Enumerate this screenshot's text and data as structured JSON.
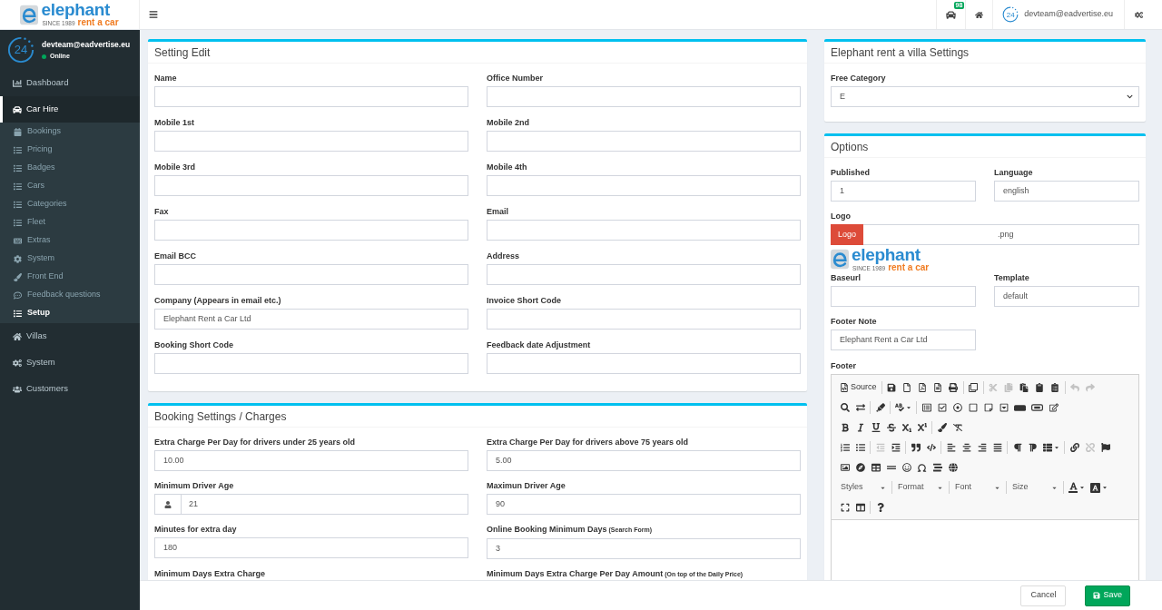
{
  "logo": {
    "name": "elephant",
    "since": "SINCE 1989",
    "tagline": "rent a car"
  },
  "navbar": {
    "notification_count": "98",
    "avatar_text": "24",
    "user_email": "devteam@eadvertise.eu"
  },
  "sidebar": {
    "user": {
      "avatar_text": "24",
      "email": "devteam@eadvertise.eu",
      "status": "Online"
    },
    "items": [
      {
        "kind": "chart",
        "label": "Dashboard",
        "selected": false
      },
      {
        "kind": "car",
        "label": "Car Hire",
        "selected": true,
        "expanded": true,
        "children": [
          {
            "kind": "calendar",
            "label": "Bookings",
            "selected": false
          },
          {
            "kind": "list",
            "label": "Pricing",
            "selected": false
          },
          {
            "kind": "list",
            "label": "Badges",
            "selected": false
          },
          {
            "kind": "list",
            "label": "Cars",
            "selected": false
          },
          {
            "kind": "list",
            "label": "Categories",
            "selected": false
          },
          {
            "kind": "list",
            "label": "Fleet",
            "selected": false
          },
          {
            "kind": "keyboard",
            "label": "Extras",
            "selected": false
          },
          {
            "kind": "gear",
            "label": "System",
            "selected": false
          },
          {
            "kind": "brush",
            "label": "Front End",
            "selected": false
          },
          {
            "kind": "comment",
            "label": "Feedback questions",
            "selected": false
          },
          {
            "kind": "list",
            "label": "Setup",
            "selected": true
          }
        ]
      },
      {
        "kind": "home",
        "label": "Villas",
        "selected": false
      },
      {
        "kind": "gears",
        "label": "System",
        "selected": false
      },
      {
        "kind": "users",
        "label": "Customers",
        "selected": false
      }
    ]
  },
  "setting_edit": {
    "title": "Setting Edit",
    "fields": [
      {
        "label": "Name"
      },
      {
        "label": "Office Number"
      },
      {
        "label": "Mobile 1st"
      },
      {
        "label": "Mobile 2nd"
      },
      {
        "label": "Mobile 3rd"
      },
      {
        "label": "Mobile 4th"
      },
      {
        "label": "Fax"
      },
      {
        "label": "Email"
      },
      {
        "label": "Email BCC"
      },
      {
        "label": "Address"
      },
      {
        "label": "Company (Appears in email etc.)",
        "value": "Elephant Rent a Car Ltd"
      },
      {
        "label": "Invoice Short Code"
      },
      {
        "label": "Booking Short Code"
      },
      {
        "label": "Feedback date Adjustment"
      }
    ]
  },
  "booking_settings": {
    "title": "Booking Settings / Charges",
    "fields": [
      {
        "kind": "text",
        "label": "Extra Charge Per Day for drivers under 25 years old",
        "value": "10.00"
      },
      {
        "kind": "text",
        "label": "Extra Charge Per Day for drivers above 75 years old",
        "value": "5.00"
      },
      {
        "kind": "addon",
        "label": "Minimum Driver Age",
        "value": "21"
      },
      {
        "kind": "text",
        "label": "Maximun Driver Age",
        "value": "90"
      },
      {
        "kind": "text",
        "label": "Minutes for extra day",
        "value": "180"
      },
      {
        "kind": "text",
        "label": "Online Booking Minimum Days",
        "hint": "(Search Form)",
        "value": "3"
      },
      {
        "kind": "text",
        "label": "Minimum Days Extra Charge"
      },
      {
        "kind": "text",
        "label": "Minimum Days Extra Charge Per Day Amount",
        "hint": "(On top of the Daily Price)"
      }
    ]
  },
  "villa_settings": {
    "title": "Elephant rent a villa Settings",
    "free_category": {
      "label": "Free Category",
      "value": "E"
    }
  },
  "options": {
    "title": "Options",
    "published": {
      "label": "Published",
      "value": "1"
    },
    "language": {
      "label": "Language",
      "value": "english"
    },
    "logo": {
      "label": "Logo",
      "button": "Logo",
      "value": ".png"
    },
    "logo_image": {
      "name": "elephant",
      "since": "SINCE 1989",
      "tagline": "rent a car"
    },
    "baseurl": {
      "label": "Baseurl"
    },
    "template": {
      "label": "Template",
      "value": "default"
    },
    "footer_note": {
      "label": "Footer Note",
      "value": "Elephant Rent a Car Ltd"
    },
    "footer": {
      "label": "Footer",
      "toolbar": [
        [
          [
            {
              "kind": "source",
              "label": "Source",
              "disabled": false
            }
          ],
          [
            {
              "kind": "save",
              "disabled": false
            },
            {
              "kind": "new_page",
              "disabled": false
            },
            {
              "kind": "export_pdf",
              "disabled": false
            },
            {
              "kind": "preview",
              "disabled": false
            },
            {
              "kind": "print",
              "disabled": false
            }
          ],
          [
            {
              "kind": "templates",
              "disabled": false
            }
          ],
          [
            {
              "kind": "cut",
              "disabled": true
            },
            {
              "kind": "copy",
              "disabled": true
            },
            {
              "kind": "paste",
              "disabled": false
            },
            {
              "kind": "paste_text",
              "disabled": false
            },
            {
              "kind": "paste_word",
              "disabled": false
            }
          ],
          [
            {
              "kind": "undo",
              "disabled": true
            },
            {
              "kind": "redo",
              "disabled": true
            }
          ]
        ],
        [
          [
            {
              "kind": "find",
              "disabled": false
            },
            {
              "kind": "replace",
              "disabled": false
            }
          ],
          [
            {
              "kind": "select_all",
              "disabled": false
            }
          ],
          [
            {
              "kind": "spellcheck",
              "disabled": false
            }
          ],
          [
            {
              "kind": "form",
              "disabled": false
            },
            {
              "kind": "checkbox",
              "disabled": false
            },
            {
              "kind": "radio",
              "disabled": false
            },
            {
              "kind": "text_field",
              "disabled": false
            },
            {
              "kind": "textarea",
              "disabled": false
            },
            {
              "kind": "select",
              "disabled": false
            },
            {
              "kind": "button",
              "disabled": false
            },
            {
              "kind": "image_button",
              "disabled": false
            },
            {
              "kind": "hidden_field",
              "disabled": false
            }
          ]
        ],
        [
          [
            {
              "kind": "bold",
              "disabled": false
            },
            {
              "kind": "italic",
              "disabled": false
            },
            {
              "kind": "underline",
              "disabled": false
            },
            {
              "kind": "strike",
              "disabled": false
            },
            {
              "kind": "subscript",
              "disabled": false
            },
            {
              "kind": "superscript",
              "disabled": false
            }
          ],
          [
            {
              "kind": "copy_format",
              "disabled": false
            },
            {
              "kind": "remove_format",
              "disabled": false
            }
          ]
        ],
        [
          [
            {
              "kind": "numbered_list",
              "disabled": false
            },
            {
              "kind": "bulleted_list",
              "disabled": false
            }
          ],
          [
            {
              "kind": "outdent",
              "disabled": true
            },
            {
              "kind": "indent",
              "disabled": false
            }
          ],
          [
            {
              "kind": "blockquote",
              "disabled": false
            },
            {
              "kind": "div",
              "disabled": false
            }
          ],
          [
            {
              "kind": "align_left",
              "disabled": false
            },
            {
              "kind": "align_center",
              "disabled": false
            },
            {
              "kind": "align_right",
              "disabled": false
            },
            {
              "kind": "align_justify",
              "disabled": false
            }
          ],
          [
            {
              "kind": "ltr",
              "disabled": false
            },
            {
              "kind": "rtl",
              "disabled": false
            },
            {
              "kind": "language",
              "disabled": false
            }
          ],
          [
            {
              "kind": "link",
              "disabled": false
            },
            {
              "kind": "unlink",
              "disabled": true
            },
            {
              "kind": "anchor",
              "disabled": false
            }
          ]
        ],
        [
          [
            {
              "kind": "image",
              "disabled": false
            },
            {
              "kind": "flash",
              "disabled": false
            },
            {
              "kind": "table",
              "disabled": false
            },
            {
              "kind": "horizontal_rule",
              "disabled": false
            },
            {
              "kind": "smiley",
              "disabled": false
            },
            {
              "kind": "special_char",
              "disabled": false
            },
            {
              "kind": "page_break",
              "disabled": false
            },
            {
              "kind": "iframe",
              "disabled": false
            }
          ]
        ],
        [
          [
            {
              "kind": "combo",
              "label": "Styles",
              "disabled": false
            }
          ],
          [
            {
              "kind": "combo",
              "label": "Format",
              "disabled": false
            }
          ],
          [
            {
              "kind": "combo",
              "label": "Font",
              "disabled": false
            }
          ],
          [
            {
              "kind": "combo",
              "label": "Size",
              "disabled": false
            }
          ],
          [
            {
              "kind": "text_color",
              "disabled": false
            },
            {
              "kind": "bg_color",
              "disabled": false
            }
          ]
        ],
        [
          [
            {
              "kind": "maximize",
              "disabled": false
            },
            {
              "kind": "show_blocks",
              "disabled": false
            }
          ],
          [
            {
              "kind": "about",
              "disabled": false
            }
          ]
        ]
      ]
    }
  },
  "actions": [
    {
      "kind": "cancel",
      "label": "Cancel"
    },
    {
      "kind": "save",
      "label": "Save"
    }
  ]
}
